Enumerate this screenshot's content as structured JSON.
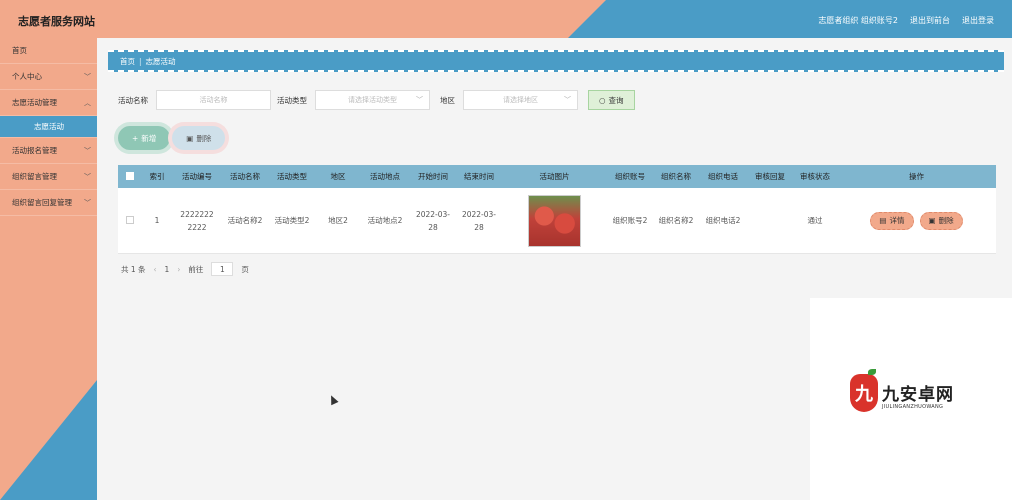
{
  "header": {
    "title": "志愿者服务网站",
    "user": "志愿者组织 组织账号2",
    "to_front": "退出到前台",
    "logout": "退出登录"
  },
  "sidebar": {
    "items": [
      {
        "label": "首页"
      },
      {
        "label": "个人中心"
      },
      {
        "label": "志愿活动管理"
      },
      {
        "label": "志愿活动"
      },
      {
        "label": "活动报名管理"
      },
      {
        "label": "组织留言管理"
      },
      {
        "label": "组织留言回复管理"
      }
    ]
  },
  "breadcrumb": {
    "home": "首页",
    "sep": "|",
    "current": "志愿活动"
  },
  "search": {
    "name_label": "活动名称",
    "name_placeholder": "活动名称",
    "type_label": "活动类型",
    "type_placeholder": "请选择活动类型",
    "area_label": "地区",
    "area_placeholder": "请选择地区",
    "query_label": "查询"
  },
  "actions": {
    "add": "新增",
    "delete": "删除"
  },
  "table": {
    "headers": [
      "索引",
      "活动编号",
      "活动名称",
      "活动类型",
      "地区",
      "活动地点",
      "开始时间",
      "结束时间",
      "活动图片",
      "组织账号",
      "组织名称",
      "组织电话",
      "审核回复",
      "审核状态",
      "操作"
    ],
    "rows": [
      {
        "index": "1",
        "code": "22222222222",
        "name": "活动名称2",
        "type": "活动类型2",
        "area": "地区2",
        "place": "活动地点2",
        "start": "2022-03-28",
        "end": "2022-03-28",
        "org_account": "组织账号2",
        "org_name": "组织名称2",
        "org_phone": "组织电话2",
        "review_reply": "",
        "review_status": "通过",
        "detail": "详情",
        "delete": "删除"
      }
    ]
  },
  "pager": {
    "total": "共 1 条",
    "page": "1",
    "goto": "前往",
    "goto_value": "1",
    "unit": "页"
  },
  "watermark": {
    "name": "九安卓网",
    "sub": "JIULINGANZHUOWANG",
    "logo_char": "九"
  },
  "icons": {
    "chevron": "chevron-down-icon",
    "search": "search-icon",
    "add": "plus-icon",
    "delete": "trash-icon",
    "detail": "detail-icon"
  },
  "colors": {
    "salmon": "#f2a98b",
    "blue": "#4a9cc6",
    "table_head": "#7fb6cf"
  }
}
